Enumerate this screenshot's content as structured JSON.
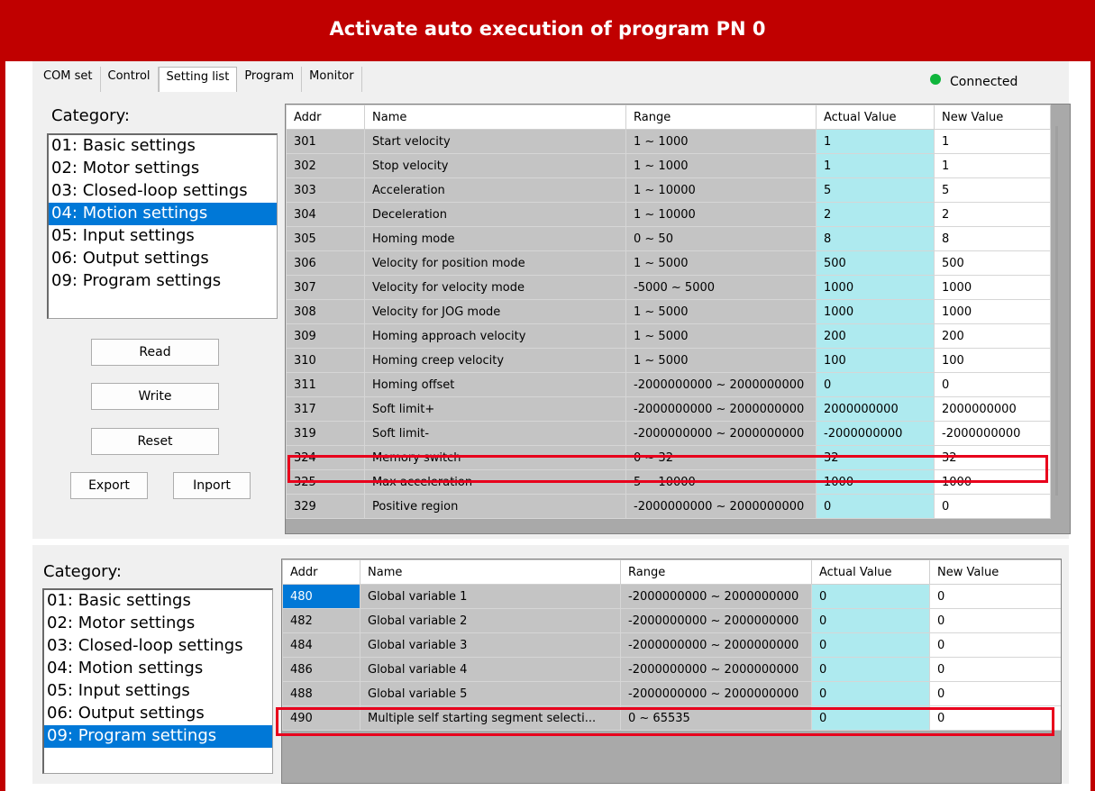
{
  "banner": {
    "title": "Activate auto execution of program PN 0"
  },
  "tabs": [
    {
      "label": "COM set"
    },
    {
      "label": "Control"
    },
    {
      "label": "Setting list"
    },
    {
      "label": "Program"
    },
    {
      "label": "Monitor"
    }
  ],
  "status": {
    "text": "Connected",
    "color": "#0fb53c"
  },
  "colors": {
    "accent": "#c00000",
    "selection": "#0078d7",
    "actual_value_bg": "#aeeaef",
    "highlight": "#e8001c"
  },
  "top_panel": {
    "category_label": "Category:",
    "categories": [
      "01: Basic settings",
      "02: Motor settings",
      "03: Closed-loop settings",
      "04: Motion settings",
      "05: Input settings",
      "06: Output settings",
      "09: Program settings"
    ],
    "selected_category": "04: Motion settings",
    "buttons": {
      "read": "Read",
      "write": "Write",
      "reset": "Reset",
      "export": "Export",
      "import": "Inport"
    },
    "columns": [
      "Addr",
      "Name",
      "Range",
      "Actual Value",
      "New Value"
    ],
    "rows": [
      {
        "addr": "301",
        "name": "Start velocity",
        "range": "1 ~ 1000",
        "actual": "1",
        "new": "1"
      },
      {
        "addr": "302",
        "name": "Stop velocity",
        "range": "1 ~ 1000",
        "actual": "1",
        "new": "1"
      },
      {
        "addr": "303",
        "name": "Acceleration",
        "range": "1 ~ 10000",
        "actual": "5",
        "new": "5"
      },
      {
        "addr": "304",
        "name": "Deceleration",
        "range": "1 ~ 10000",
        "actual": "2",
        "new": "2"
      },
      {
        "addr": "305",
        "name": "Homing mode",
        "range": "0 ~ 50",
        "actual": "8",
        "new": "8"
      },
      {
        "addr": "306",
        "name": "Velocity for position mode",
        "range": "1 ~ 5000",
        "actual": "500",
        "new": "500"
      },
      {
        "addr": "307",
        "name": "Velocity for velocity mode",
        "range": "-5000 ~ 5000",
        "actual": "1000",
        "new": "1000"
      },
      {
        "addr": "308",
        "name": "Velocity for JOG mode",
        "range": "1 ~ 5000",
        "actual": "1000",
        "new": "1000"
      },
      {
        "addr": "309",
        "name": "Homing approach velocity",
        "range": "1 ~ 5000",
        "actual": "200",
        "new": "200"
      },
      {
        "addr": "310",
        "name": "Homing creep velocity",
        "range": "1 ~ 5000",
        "actual": "100",
        "new": "100"
      },
      {
        "addr": "311",
        "name": "Homing offset",
        "range": "-2000000000 ~ 2000000000",
        "actual": "0",
        "new": "0"
      },
      {
        "addr": "317",
        "name": "Soft limit+",
        "range": "-2000000000 ~ 2000000000",
        "actual": "2000000000",
        "new": "2000000000"
      },
      {
        "addr": "319",
        "name": "Soft limit-",
        "range": "-2000000000 ~ 2000000000",
        "actual": "-2000000000",
        "new": "-2000000000"
      },
      {
        "addr": "324",
        "name": "Memory switch",
        "range": "0 ~ 32",
        "actual": "32",
        "new": "32"
      },
      {
        "addr": "325",
        "name": "Max acceleration",
        "range": "5 ~ 10000",
        "actual": "1000",
        "new": "1000"
      },
      {
        "addr": "329",
        "name": "Positive region",
        "range": "-2000000000 ~ 2000000000",
        "actual": "0",
        "new": "0"
      }
    ]
  },
  "bottom_panel": {
    "category_label": "Category:",
    "categories": [
      "01: Basic settings",
      "02: Motor settings",
      "03: Closed-loop settings",
      "04: Motion settings",
      "05: Input settings",
      "06: Output settings",
      "09: Program settings"
    ],
    "selected_category": "09: Program settings",
    "columns": [
      "Addr",
      "Name",
      "Range",
      "Actual Value",
      "New Value"
    ],
    "rows": [
      {
        "addr": "480",
        "name": "Global variable 1",
        "range": "-2000000000 ~ 2000000000",
        "actual": "0",
        "new": "0"
      },
      {
        "addr": "482",
        "name": "Global variable 2",
        "range": "-2000000000 ~ 2000000000",
        "actual": "0",
        "new": "0"
      },
      {
        "addr": "484",
        "name": "Global variable 3",
        "range": "-2000000000 ~ 2000000000",
        "actual": "0",
        "new": "0"
      },
      {
        "addr": "486",
        "name": "Global variable 4",
        "range": "-2000000000 ~ 2000000000",
        "actual": "0",
        "new": "0"
      },
      {
        "addr": "488",
        "name": "Global variable 5",
        "range": "-2000000000 ~ 2000000000",
        "actual": "0",
        "new": "0"
      },
      {
        "addr": "490",
        "name": "Multiple self starting segment selecti...",
        "range": "0 ~ 65535",
        "actual": "0",
        "new": "0"
      }
    ]
  }
}
